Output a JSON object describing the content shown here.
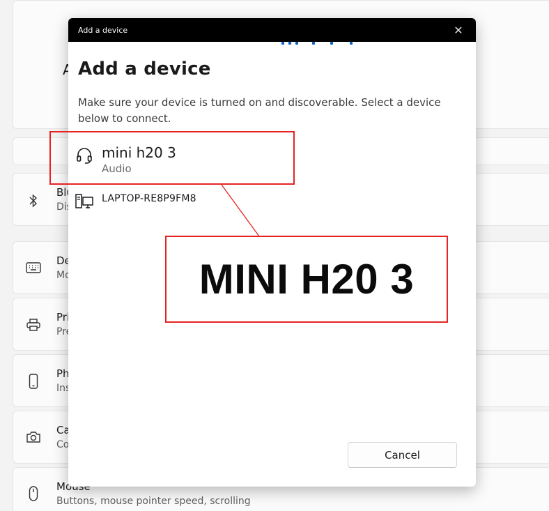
{
  "dialog": {
    "window_title": "Add a device",
    "close_glyph": "✕",
    "heading": "Add a device",
    "description": "Make sure your device is turned on and discoverable. Select a device below to connect.",
    "devices": [
      {
        "name": "mini h20 3",
        "type": "Audio",
        "icon": "headphones-icon"
      },
      {
        "name": "LAPTOP-RE8P9FM8",
        "type": "",
        "icon": "computer-icon"
      }
    ],
    "cancel_label": "Cancel"
  },
  "annotation": {
    "callout_text": "MINI H20 3",
    "color": "#e52323"
  },
  "background": {
    "header_letter": "A",
    "items": [
      {
        "icon": "bluetooth-icon",
        "title": "Blu",
        "subtitle": "Dis"
      },
      {
        "icon": "keyboard-icon",
        "title": "De",
        "subtitle": "Mo"
      },
      {
        "icon": "printer-icon",
        "title": "Pri",
        "subtitle": "Pre"
      },
      {
        "icon": "phone-icon",
        "title": "Ph",
        "subtitle": "Ins"
      },
      {
        "icon": "camera-icon",
        "title": "Ca",
        "subtitle": "Co"
      },
      {
        "icon": "mouse-icon",
        "title": "Mouse",
        "subtitle": "Buttons, mouse pointer speed, scrolling"
      }
    ]
  },
  "colors": {
    "accent": "#0a5fc8",
    "titlebar": "#000000",
    "annotation_red": "#e52323"
  }
}
